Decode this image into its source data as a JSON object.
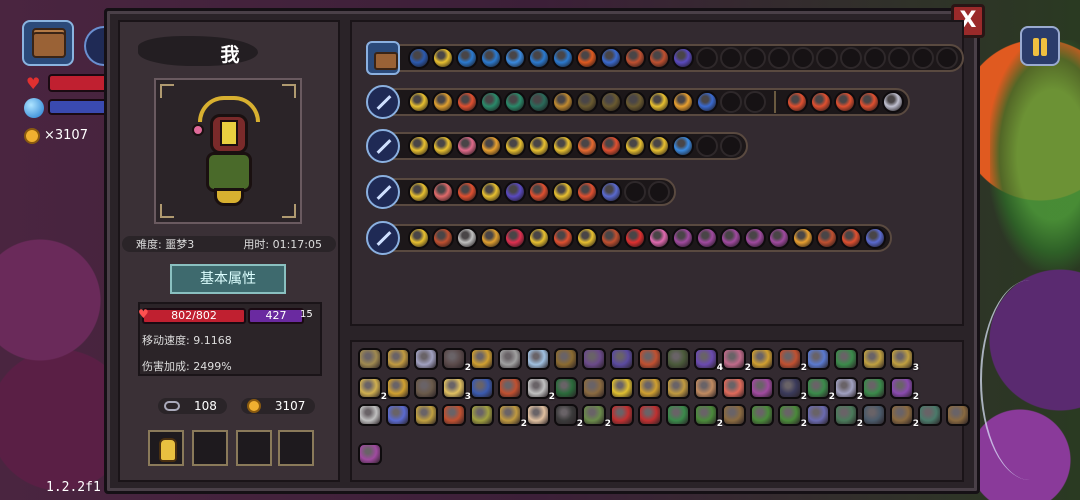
{
  "hud": {
    "coins": "×3107",
    "version": "1.2.2f1"
  },
  "character": {
    "name": "我",
    "difficulty": "难度: 噩梦3",
    "playtime": "用时: 01:17:05",
    "attr_button": "基本属性",
    "hp": "802/802",
    "mp": "427",
    "shield": "15",
    "move_speed": "移动速度: 9.1168",
    "damage_bonus": "伤害加成: 2499%",
    "keys": "108",
    "gold": "3107"
  },
  "close_label": "X",
  "colors": {
    "panel_bg": "#2a2328",
    "accent_gold": "#d8b030",
    "hp_red": "#c02030",
    "mp_purple": "#6a2aa0",
    "close_red": "#9a2a2a"
  },
  "weapon_rows": [
    {
      "weapon_icon": "treasure-chest-icon",
      "cells": [
        "#2b5ab0",
        "#e8c030",
        "#2b7ad0",
        "#2b7ad0",
        "#3a8ae0",
        "#2b7ad0",
        "#2b7ad0",
        "#e05a20",
        "#3a6ad0",
        "#c05030",
        "#c05030",
        "#5a4ac0",
        "",
        "",
        "",
        "",
        "",
        "",
        "",
        "",
        "",
        "",
        ""
      ]
    },
    {
      "weapon_icon": "staff-icon",
      "cells": [
        "#e8c030",
        "#e0a030",
        "#e05030",
        "#2a8a6a",
        "#2a8a6a",
        "#2a6a5a",
        "#c08a30",
        "#6a5a30",
        "#6a5a30",
        "#6a5a30",
        "#e8c030",
        "#e8a030",
        "#3a6ad0",
        "",
        "",
        "|",
        "#e05030",
        "#e05030",
        "#e05030",
        "#e05030",
        "#c0c0d0"
      ]
    },
    {
      "weapon_icon": "staff-icon",
      "cells": [
        "#e8c030",
        "#e8c030",
        "#e06a8a",
        "#e8a030",
        "#e8c030",
        "#e8c030",
        "#e8c030",
        "#e86a30",
        "#e05030",
        "#e8c030",
        "#e8c030",
        "#3a8ae0",
        "",
        ""
      ]
    },
    {
      "weapon_icon": "staff-icon",
      "cells": [
        "#e8c030",
        "#e06a6a",
        "#e05030",
        "#e8c030",
        "#5a4ac0",
        "#e05030",
        "#e8c030",
        "#e05030",
        "#5a6ad0",
        "",
        ""
      ]
    },
    {
      "weapon_icon": "staff-icon",
      "cells": [
        "#e8c030",
        "#c05030",
        "#c0c0c0",
        "#e0a030",
        "#e03050",
        "#e8c030",
        "#e05030",
        "#e8c030",
        "#c05030",
        "#e03030",
        "#e06ab0",
        "#a04aa0",
        "#a04aa0",
        "#a04aa0",
        "#a04aa0",
        "#a04aa0",
        "#e8a030",
        "#c05030",
        "#e05030",
        "#5a6ad0"
      ]
    }
  ],
  "items": [
    [
      {
        "c": "#a08a50"
      },
      {
        "c": "#c09a40"
      },
      {
        "c": "#a0a0c0"
      },
      {
        "c": "#5a4a4a",
        "n": "2"
      },
      {
        "c": "#d0a030"
      },
      {
        "c": "#a0a0a0"
      },
      {
        "c": "#a0c0e0"
      },
      {
        "c": "#8a6a30"
      },
      {
        "c": "#6a4a8a"
      },
      {
        "c": "#5a4aa0"
      },
      {
        "c": "#c05030"
      },
      {
        "c": "#4a5a3a"
      },
      {
        "c": "#6a4ab0",
        "n": "4"
      },
      {
        "c": "#c06a8a",
        "n": "2"
      },
      {
        "c": "#d0a030"
      },
      {
        "c": "#c05030",
        "n": "2"
      },
      {
        "c": "#5a7ad0"
      },
      {
        "c": "#3a8a4a"
      },
      {
        "c": "#c0a040"
      },
      {
        "c": "#c0a040",
        "n": "3"
      }
    ],
    [
      {
        "c": "#d0b050",
        "n": "2"
      },
      {
        "c": "#d0a030"
      },
      {
        "c": "#6a5a4a"
      },
      {
        "c": "#e0c060",
        "n": "3"
      },
      {
        "c": "#3a5ab0"
      },
      {
        "c": "#c05030"
      },
      {
        "c": "#c0c0c0",
        "n": "2"
      },
      {
        "c": "#2a6a3a"
      },
      {
        "c": "#8a6a40"
      },
      {
        "c": "#e0c030"
      },
      {
        "c": "#d0a030"
      },
      {
        "c": "#c09a40"
      },
      {
        "c": "#c08a60"
      },
      {
        "c": "#e06a5a"
      },
      {
        "c": "#a04aa0"
      },
      {
        "c": "#3a3a5a",
        "n": "2"
      },
      {
        "c": "#3a8a4a",
        "n": "2"
      },
      {
        "c": "#a0a0c0",
        "n": "2"
      },
      {
        "c": "#3a8a4a"
      },
      {
        "c": "#8a4ab0",
        "n": "2"
      }
    ],
    [
      {
        "c": "#c0c0c0"
      },
      {
        "c": "#5a6ad0"
      },
      {
        "c": "#c0a040"
      },
      {
        "c": "#c05030"
      },
      {
        "c": "#a0a040"
      },
      {
        "c": "#c09a40",
        "n": "2"
      },
      {
        "c": "#e0c0a0"
      },
      {
        "c": "#3a3a3a",
        "n": "2"
      },
      {
        "c": "#6a8a4a",
        "n": "2"
      },
      {
        "c": "#c03030"
      },
      {
        "c": "#c03030"
      },
      {
        "c": "#3a8a4a"
      },
      {
        "c": "#4a8a3a",
        "n": "2"
      },
      {
        "c": "#8a6a40"
      },
      {
        "c": "#4a8a3a"
      },
      {
        "c": "#4a8a3a",
        "n": "2"
      },
      {
        "c": "#6a6ab0"
      },
      {
        "c": "#4a7a5a",
        "n": "2"
      },
      {
        "c": "#4a5a6a"
      },
      {
        "c": "#8a6a40",
        "n": "2"
      },
      {
        "c": "#4a7a6a"
      },
      {
        "c": "#8a6a40"
      }
    ],
    [
      {
        "c": "#a04aa0"
      }
    ]
  ]
}
